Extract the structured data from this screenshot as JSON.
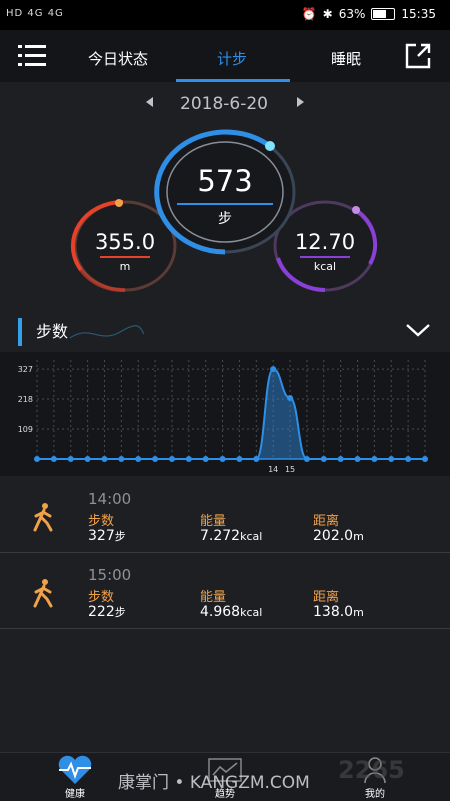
{
  "status_bar": {
    "left_indicators": "HD 4G 4G",
    "battery_percent": "63%",
    "battery_level": 0.63,
    "time": "15:35"
  },
  "header": {
    "tabs": [
      "今日状态",
      "计步",
      "睡眠"
    ],
    "active_tab": "计步"
  },
  "date": "2018-6-20",
  "rings": {
    "steps": {
      "value": "573",
      "unit": "步",
      "color": "#2f8ee6"
    },
    "distance": {
      "value": "355.0",
      "unit": "m",
      "color": "#e8412a"
    },
    "calories": {
      "value": "12.70",
      "unit": "kcal",
      "color": "#8a3fd6"
    }
  },
  "section": {
    "title": "步数"
  },
  "chart_data": {
    "type": "area",
    "yticks": [
      109,
      218,
      327
    ],
    "ylim": [
      0,
      360
    ],
    "x": [
      0,
      1,
      2,
      3,
      4,
      5,
      6,
      7,
      8,
      9,
      10,
      11,
      12,
      13,
      14,
      15,
      16,
      17,
      18,
      19,
      20,
      21,
      22,
      23
    ],
    "values": [
      0,
      0,
      0,
      0,
      0,
      0,
      0,
      0,
      0,
      0,
      0,
      0,
      0,
      0,
      327,
      222,
      0,
      0,
      0,
      0,
      0,
      0,
      0,
      0
    ],
    "xtick_labels": [
      {
        "x": 14,
        "label": "14"
      },
      {
        "x": 15,
        "label": "15"
      }
    ],
    "color": "#2f8ee6"
  },
  "records": [
    {
      "time": "14:00",
      "steps_label": "步数",
      "steps_value": "327",
      "steps_unit": "步",
      "energy_label": "能量",
      "energy_value": "7.272",
      "energy_unit": "kcal",
      "distance_label": "距离",
      "distance_value": "202.0",
      "distance_unit": "m"
    },
    {
      "time": "15:00",
      "steps_label": "步数",
      "steps_value": "222",
      "steps_unit": "步",
      "energy_label": "能量",
      "energy_value": "4.968",
      "energy_unit": "kcal",
      "distance_label": "距离",
      "distance_value": "138.0",
      "distance_unit": "m"
    }
  ],
  "bottom_nav": {
    "items": [
      {
        "label": "健康",
        "icon": "heart-pulse-icon"
      },
      {
        "label": "趋势",
        "icon": "trend-chart-icon"
      },
      {
        "label": "我的",
        "icon": "person-icon"
      }
    ]
  },
  "watermark": "康掌门 • KANGZM.COM",
  "watermark2": "2265"
}
